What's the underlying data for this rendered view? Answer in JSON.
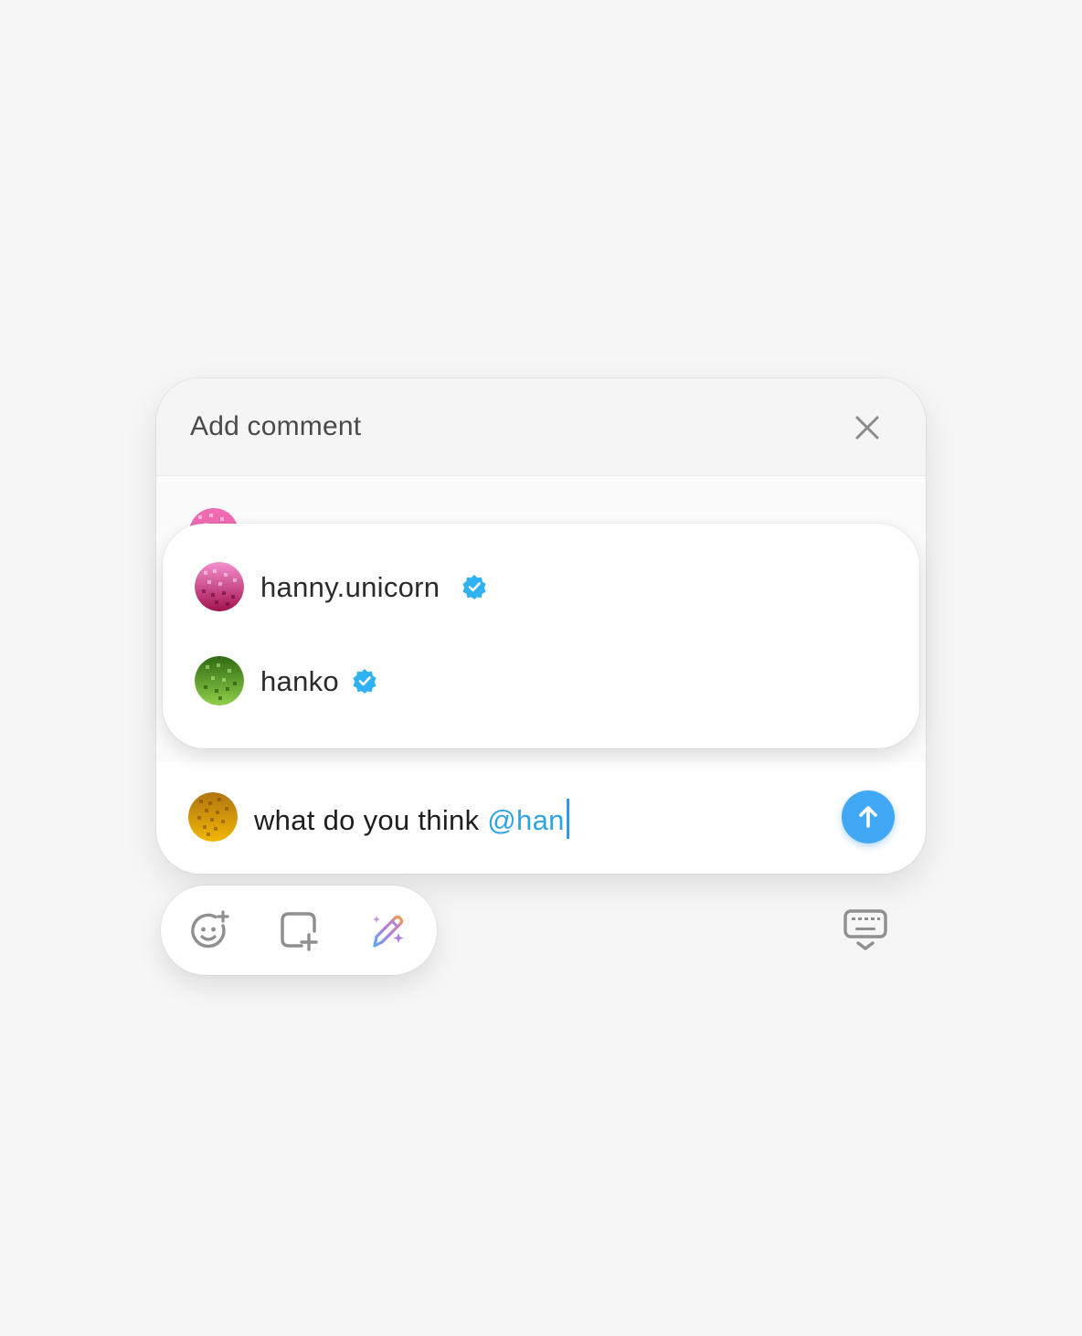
{
  "dialog": {
    "title": "Add comment",
    "close_icon": "close-icon"
  },
  "colors": {
    "background": "#f6f6f6",
    "accent": "#41a8f5",
    "mention": "#2fa4e2",
    "verified": "#2fb2f2"
  },
  "suggestions": [
    {
      "username": "hanny.unicorn",
      "verified": true,
      "avatar_color": "#e0479a"
    },
    {
      "username": "hanko",
      "verified": true,
      "avatar_color": "#4f9c2a"
    }
  ],
  "composer": {
    "text": "what do you think ",
    "mention": "@han",
    "avatar_color": "#d99a12",
    "send_icon": "arrow-up-icon"
  },
  "toolbar": {
    "icons": [
      "emoji-add-icon",
      "add-media-icon",
      "ai-magic-pen-icon"
    ],
    "keyboard_icon": "keyboard-hide-icon"
  }
}
